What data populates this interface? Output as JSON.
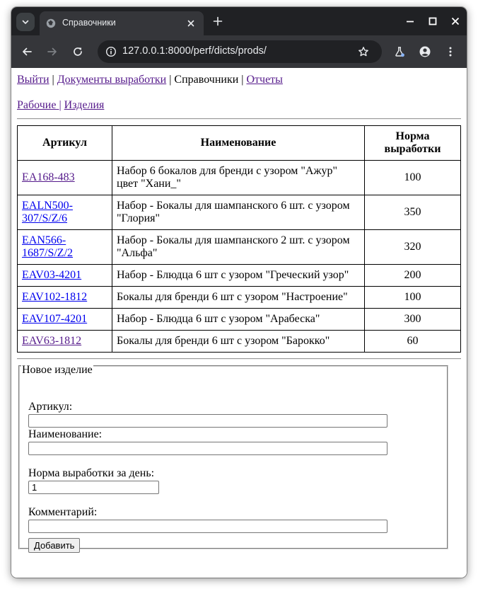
{
  "browser": {
    "tab_title": "Справочники",
    "url": "127.0.0.1:8000/perf/dicts/prods/"
  },
  "nav": {
    "logout": "Выйти",
    "sep1": "|",
    "documents": "Документы выработки",
    "sep2": "|",
    "directories": "Справочники",
    "sep3": "|",
    "reports": "Отчеты"
  },
  "subnav": {
    "workers": "Рабочие",
    "sep": "|",
    "products": "Изделия"
  },
  "table": {
    "headers": {
      "article": "Артикул",
      "name": "Наименование",
      "norm": "Норма выработки"
    },
    "rows": [
      {
        "article": "EA168-483",
        "name": "Набор 6 бокалов для бренди с узором \"Ажур\" цвет \"Хани_\"",
        "norm": "100"
      },
      {
        "article": "EALN500-307/S/Z/6",
        "name": "Набор - Бокалы для шампанского 6 шт. с узором \"Глория\"",
        "norm": "350"
      },
      {
        "article": "EAN566-1687/S/Z/2",
        "name": "Набор - Бокалы для шампанского 2 шт. с узором \"Альфа\"",
        "norm": "320"
      },
      {
        "article": "EAV03-4201",
        "name": "Набор - Блюдца 6 шт с узором \"Греческий узор\"",
        "norm": "200"
      },
      {
        "article": "EAV102-1812",
        "name": "Бокалы для бренди 6 шт с узором \"Настроение\"",
        "norm": "100"
      },
      {
        "article": "EAV107-4201",
        "name": "Набор - Блюдца 6 шт с узором \"Арабеска\"",
        "norm": "300"
      },
      {
        "article": "EAV63-1812",
        "name": "Бокалы для бренди 6 шт с узором \"Барокко\"",
        "norm": "60"
      }
    ]
  },
  "form": {
    "legend": "Новое изделие",
    "article_label": "Артикул:",
    "article_value": "",
    "name_label": "Наименование:",
    "name_value": "",
    "norm_label": "Норма выработки за день:",
    "norm_value": "1",
    "comment_label": "Комментарий:",
    "comment_value": "",
    "submit": "Добавить"
  },
  "colors": {
    "visited_link": "#551a8b",
    "link": "#0000ee",
    "tabstrip": "#202124",
    "toolbar": "#35363a"
  }
}
